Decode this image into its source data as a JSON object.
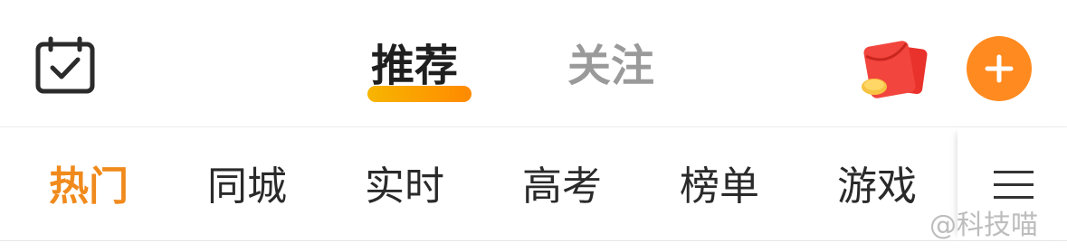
{
  "header": {
    "tabs": [
      {
        "label": "推荐",
        "active": true
      },
      {
        "label": "关注",
        "active": false
      }
    ],
    "icons": {
      "left": "calendar-check-icon",
      "redpacket": "red-packet-icon",
      "add": "plus-icon"
    }
  },
  "channels": [
    {
      "label": "热门",
      "active": true
    },
    {
      "label": "同城",
      "active": false
    },
    {
      "label": "实时",
      "active": false
    },
    {
      "label": "高考",
      "active": false
    },
    {
      "label": "榜单",
      "active": false
    },
    {
      "label": "游戏",
      "active": false
    }
  ],
  "menu_icon": "hamburger-menu-icon",
  "watermark": "@科技喵",
  "colors": {
    "accent": "#ff8a1f",
    "active_channel": "#f08a1c",
    "underline_start": "#f7b500",
    "underline_end": "#ff8a00",
    "inactive_tab": "#9a9a9a",
    "text": "#2a2a2a"
  }
}
